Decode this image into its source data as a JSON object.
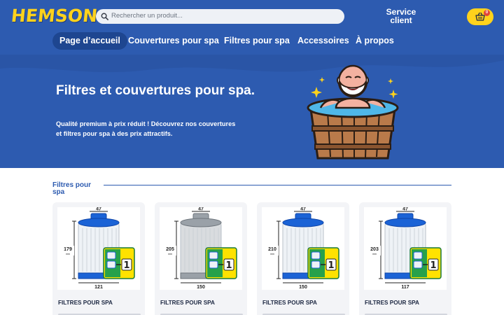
{
  "header": {
    "logo": "HEMSON",
    "search_placeholder": "Rechercher un produit...",
    "service_line1": "Service",
    "service_line2": "client",
    "cart_count": "0"
  },
  "nav": {
    "items": [
      {
        "label": "Page d’accueil",
        "active": true
      },
      {
        "label": "Couvertures pour spa"
      },
      {
        "label": "Filtres pour spa"
      },
      {
        "label": "Accessoires"
      },
      {
        "label": "À propos"
      }
    ]
  },
  "hero": {
    "title": "Filtres et couvertures pour spa.",
    "subtitle": "Qualité premium à prix réduit ! Découvrez nos couvertures et filtres pour spa à des prix attractifs."
  },
  "section": {
    "title": "Filtres pour spa"
  },
  "products": [
    {
      "category": "FILTRES POUR SPA",
      "top_dim": "47",
      "height_dim": "179",
      "height_unit": "mm",
      "bottom_dim": "121",
      "cap": "blue"
    },
    {
      "category": "FILTRES POUR SPA",
      "top_dim": "47",
      "height_dim": "205",
      "height_unit": "mm",
      "bottom_dim": "150",
      "cap": "grey"
    },
    {
      "category": "FILTRES POUR SPA",
      "top_dim": "47",
      "height_dim": "210",
      "height_unit": "mm",
      "bottom_dim": "150",
      "cap": "blue"
    },
    {
      "category": "FILTRES POUR SPA",
      "top_dim": "47",
      "height_dim": "203",
      "height_unit": "mm",
      "bottom_dim": "117",
      "cap": "blue"
    }
  ],
  "colors": {
    "brand_blue": "#2d5bb0",
    "dark_blue": "#1e4690",
    "accent_yellow": "#ffd21c",
    "badge_red": "#e2453a"
  }
}
